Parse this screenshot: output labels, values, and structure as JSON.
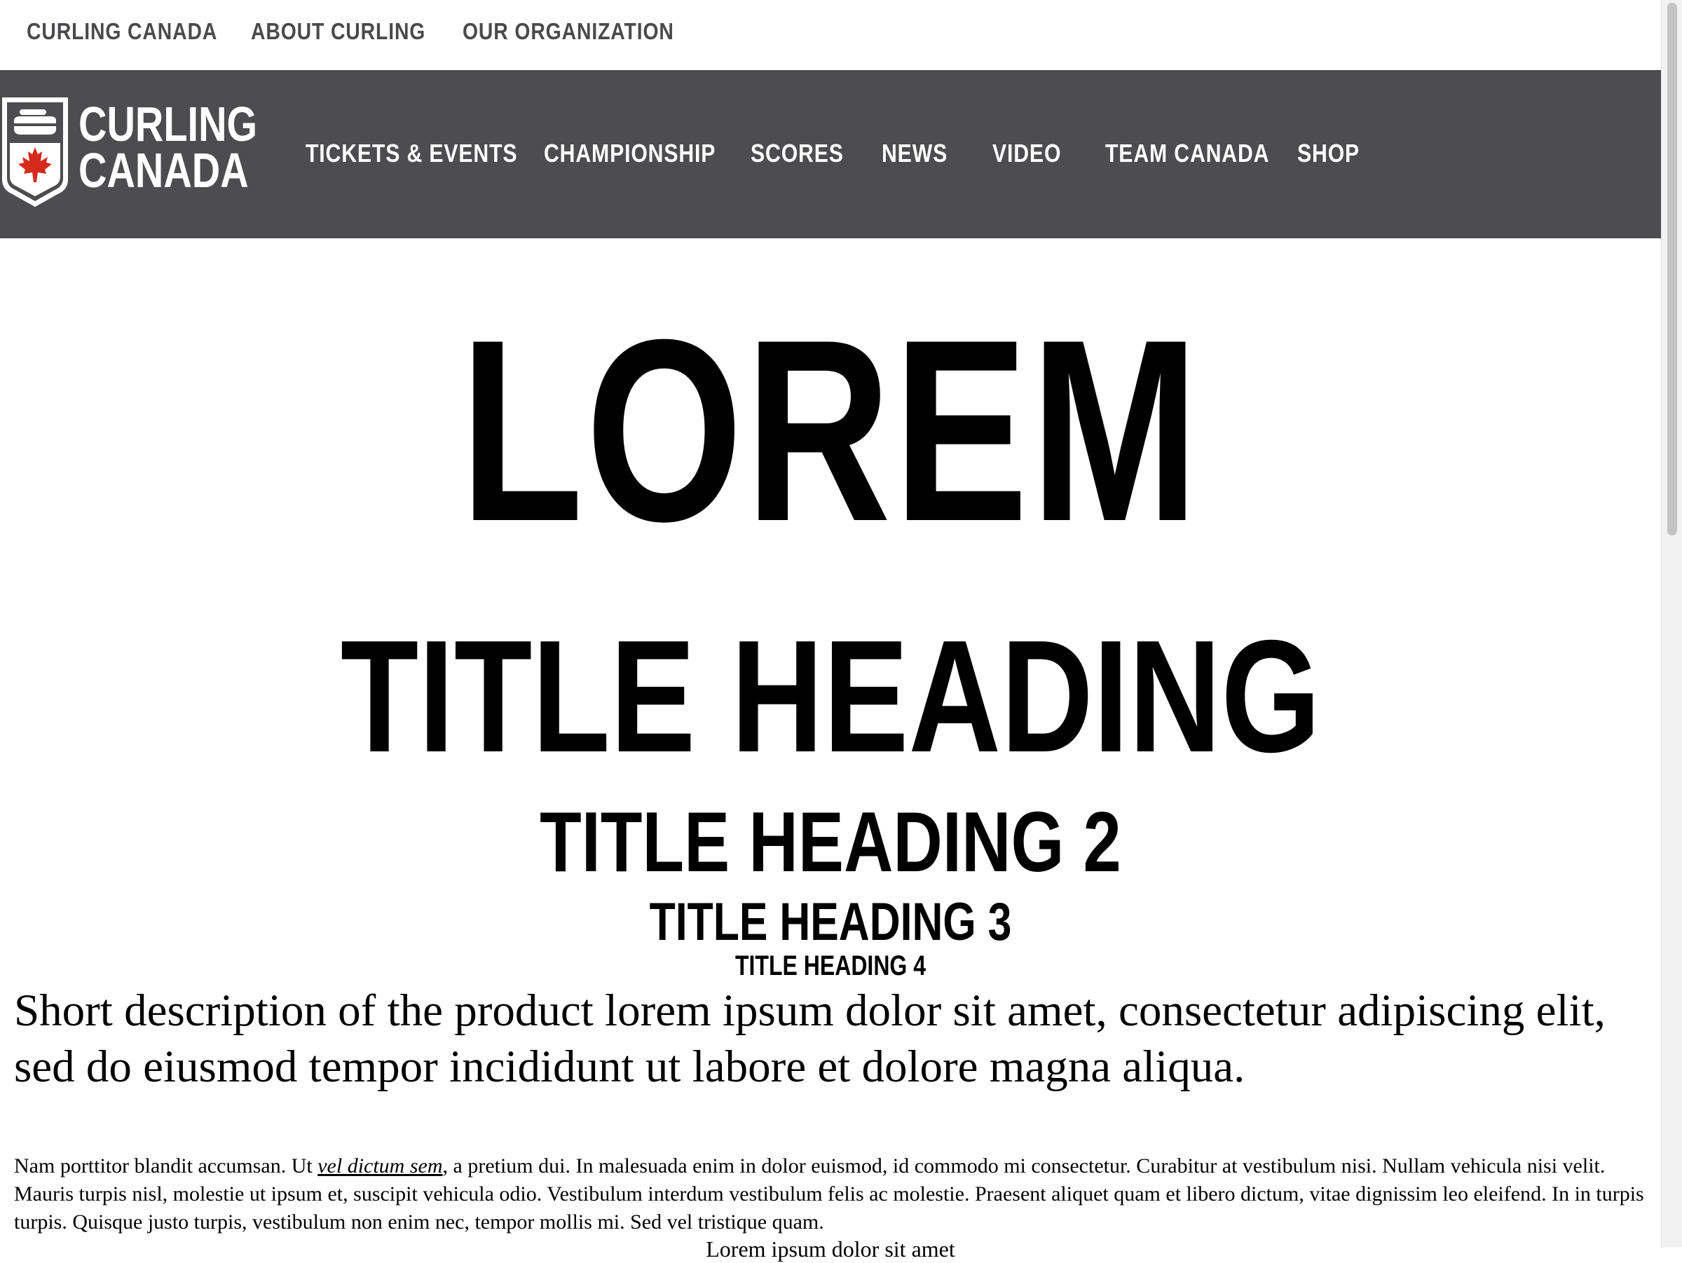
{
  "utility_nav": {
    "items": [
      {
        "label": "CURLING CANADA"
      },
      {
        "label": "ABOUT CURLING"
      },
      {
        "label": "OUR ORGANIZATION"
      }
    ]
  },
  "main_nav": {
    "logo": {
      "line1": "CURLING",
      "line2": "CANADA"
    },
    "items": [
      {
        "label": "TICKETS & EVENTS"
      },
      {
        "label": "CHAMPIONSHIP"
      },
      {
        "label": "SCORES"
      },
      {
        "label": "NEWS"
      },
      {
        "label": "VIDEO"
      },
      {
        "label": "TEAM CANADA"
      },
      {
        "label": "SHOP"
      }
    ]
  },
  "content": {
    "display": "LOREM",
    "h1": "TITLE HEADING",
    "h2": "TITLE HEADING 2",
    "h3": "TITLE HEADING 3",
    "h4": "TITLE HEADING 4",
    "lead": "Short description of the product lorem ipsum dolor sit amet, consectetur adipiscing elit, sed do eiusmod tempor incididunt ut labore et dolore magna aliqua.",
    "body": {
      "before_link": "Nam porttitor blandit accumsan. Ut ",
      "link": "vel dictum sem",
      "after_link": ", a pretium dui. In malesuada enim in dolor euismod, id commodo mi consectetur. Curabitur at vestibulum nisi. Nullam vehicula nisi velit. Mauris turpis nisl, molestie ut ipsum et, suscipit vehicula odio. Vestibulum interdum vestibulum felis ac molestie. Praesent aliquet quam et libero dictum, vitae dignissim leo eleifend. In in turpis turpis. Quisque justo turpis, vestibulum non enim nec, tempor mollis mi. Sed vel tristique quam."
    },
    "cutoff_line": "Lorem ipsum dolor sit amet"
  },
  "colors": {
    "nav_bg": "#4d4d4f",
    "utility_text": "#4a4a4c",
    "brand_red": "#d52b1e",
    "white": "#ffffff"
  },
  "icons": [
    "curling-canada-shield-logo",
    "curling-stone-icon",
    "maple-leaf-icon"
  ]
}
